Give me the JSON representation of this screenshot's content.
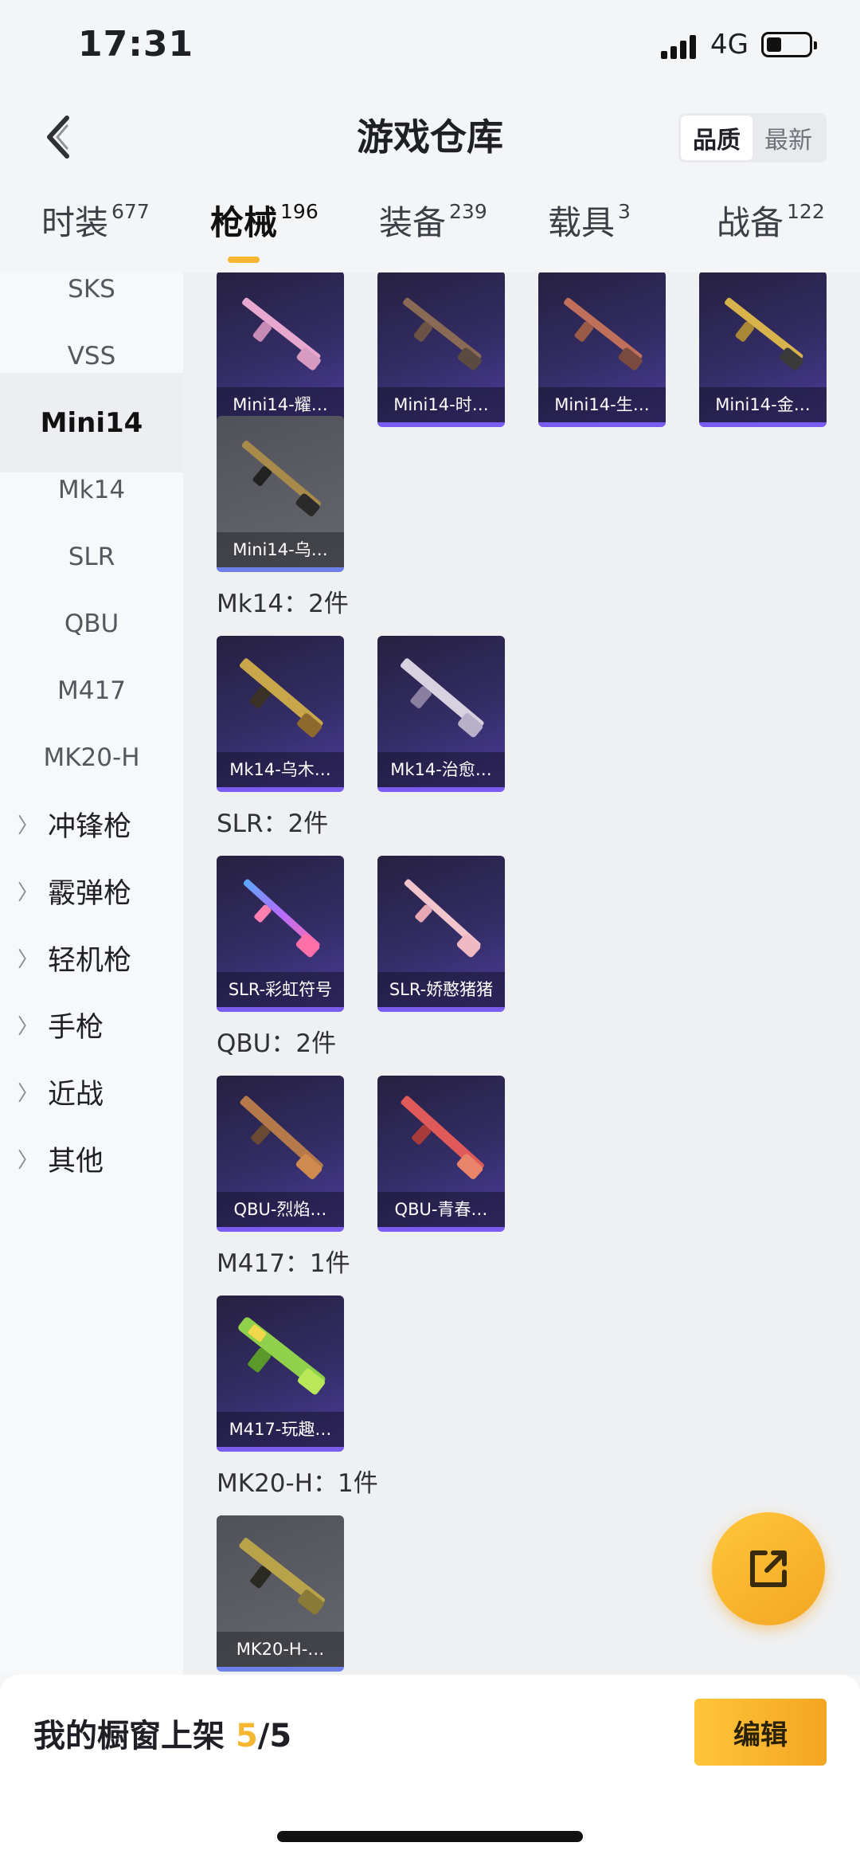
{
  "status": {
    "time": "17:31",
    "network": "4G"
  },
  "header": {
    "title": "游戏仓库",
    "sort_options": [
      "品质",
      "最新"
    ],
    "sort_active": "品质"
  },
  "tabs": [
    {
      "label": "时装",
      "count": "677"
    },
    {
      "label": "枪械",
      "count": "196",
      "active": true
    },
    {
      "label": "装备",
      "count": "239"
    },
    {
      "label": "载具",
      "count": "3"
    },
    {
      "label": "战备",
      "count": "122"
    }
  ],
  "sidebar": {
    "subitems": [
      "SKS",
      "VSS",
      "Mini14",
      "Mk14",
      "SLR",
      "QBU",
      "M417",
      "MK20-H"
    ],
    "active": "Mini14",
    "categories": [
      "冲锋枪",
      "霰弹枪",
      "轻机枪",
      "手枪",
      "近战",
      "其他"
    ]
  },
  "sections": [
    {
      "title": "",
      "items": [
        "Mini14-耀…",
        "Mini14-时…",
        "Mini14-生…",
        "Mini14-金…",
        "Mini14-乌…"
      ]
    },
    {
      "title": "Mk14：2件",
      "items": [
        "Mk14-乌木…",
        "Mk14-治愈…"
      ]
    },
    {
      "title": "SLR：2件",
      "items": [
        "SLR-彩虹符号",
        "SLR-娇憨猪猪"
      ]
    },
    {
      "title": "QBU：2件",
      "items": [
        "QBU-烈焰…",
        "QBU-青春…"
      ]
    },
    {
      "title": "M417：1件",
      "items": [
        "M417-玩趣…"
      ]
    },
    {
      "title": "MK20-H：1件",
      "items": [
        "MK20-H-…"
      ]
    }
  ],
  "bottom": {
    "shelf_label": "我的橱窗上架 ",
    "shelf_current": "5",
    "shelf_total": "/5",
    "edit_label": "编辑"
  },
  "colors": {
    "accent": "#f5b731",
    "card_purple": "#332d66",
    "card_gray": "#5d5e66"
  },
  "icons": {
    "back": "chevron-left-icon",
    "fab": "share-export-icon"
  }
}
